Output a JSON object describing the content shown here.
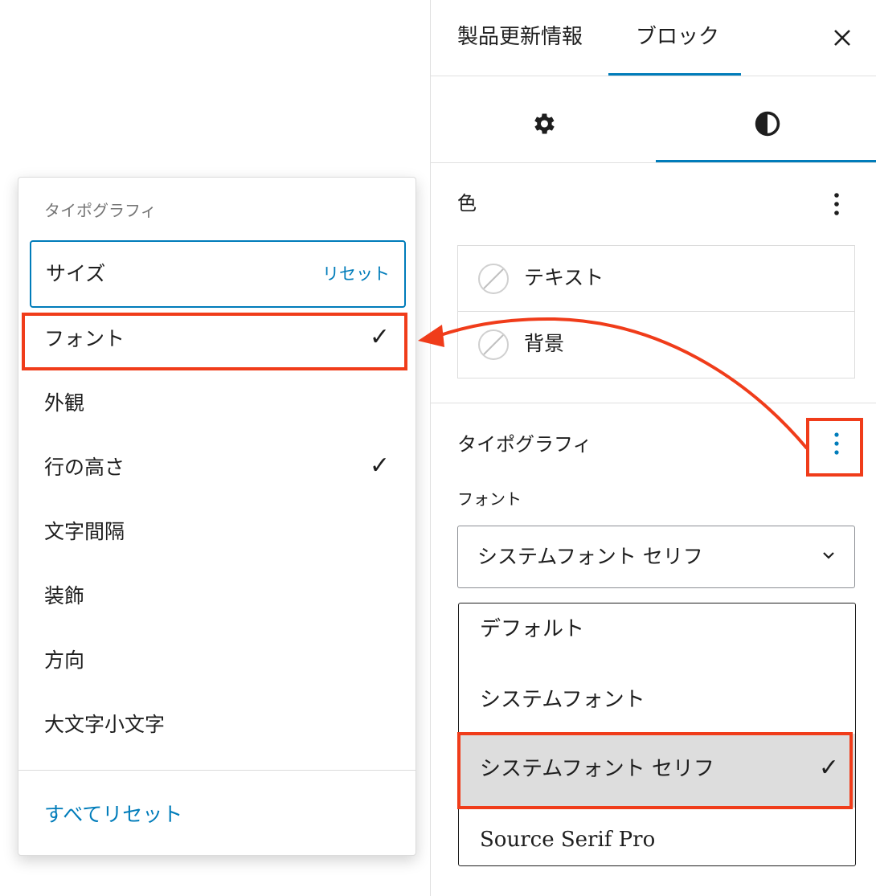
{
  "sidebar": {
    "tabs": [
      {
        "label": "製品更新情報"
      },
      {
        "label": "ブロック"
      }
    ],
    "close_icon": "close-icon",
    "subtabs": {
      "settings_icon": "gear-icon",
      "styles_icon": "contrast-icon"
    },
    "color_panel": {
      "title": "色",
      "items": [
        {
          "label": "テキスト"
        },
        {
          "label": "背景"
        }
      ]
    },
    "typography_panel": {
      "title": "タイポグラフィ",
      "font_label": "フォント",
      "selected_font": "システムフォント セリフ",
      "options": [
        {
          "label": "デフォルト"
        },
        {
          "label": "システムフォント"
        },
        {
          "label": "システムフォント セリフ",
          "checked": "✓"
        },
        {
          "label": "Source Serif Pro"
        }
      ]
    }
  },
  "popover": {
    "heading": "タイポグラフィ",
    "items": [
      {
        "label": "サイズ",
        "reset": "リセット"
      },
      {
        "label": "フォント",
        "check": "✓"
      },
      {
        "label": "外観"
      },
      {
        "label": "行の高さ",
        "check": "✓"
      },
      {
        "label": "文字間隔"
      },
      {
        "label": "装飾"
      },
      {
        "label": "方向"
      },
      {
        "label": "大文字小文字"
      }
    ],
    "reset_all": "すべてリセット"
  },
  "colors": {
    "accent": "#007cba",
    "highlight": "#f03c1a"
  }
}
